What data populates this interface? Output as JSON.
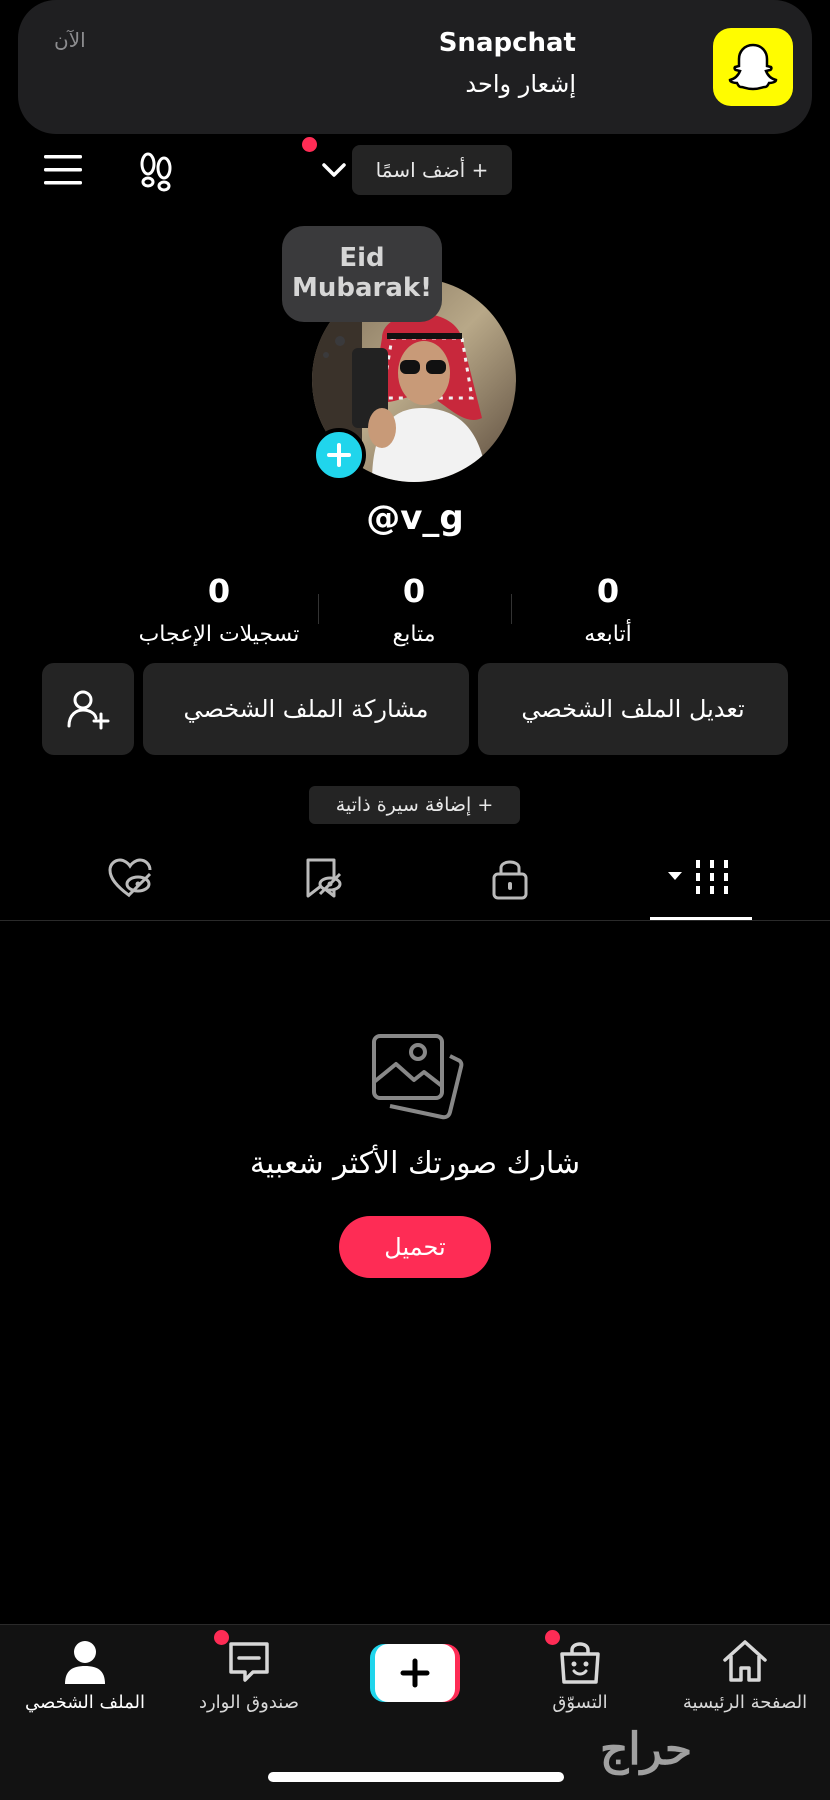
{
  "notification": {
    "app": "Snapchat",
    "body": "إشعار واحد",
    "time": "الآن",
    "icon": "snapchat-ghost-icon",
    "accent": "#fffc00"
  },
  "topbar": {
    "add_name_label": "+ أضف اسمًا",
    "menu_icon": "hamburger-menu-icon",
    "footsteps_icon": "footprints-icon"
  },
  "profile": {
    "bubble_text": "Eid Mubarak!",
    "username": "@v_g",
    "stats": [
      {
        "value": "0",
        "label": "أتابعه"
      },
      {
        "value": "0",
        "label": "متابع"
      },
      {
        "value": "0",
        "label": "تسجيلات الإعجاب"
      }
    ],
    "edit_button": "تعديل الملف الشخصي",
    "share_button": "مشاركة الملف الشخصي",
    "bio_button": "+ إضافة سيرة ذاتية"
  },
  "tabs": [
    "videos-grid-icon",
    "lock-icon",
    "bookmark-hidden-icon",
    "liked-hidden-icon"
  ],
  "empty_state": {
    "text": "شارك صورتك الأكثر شعبية",
    "upload_label": "تحميل"
  },
  "bottom_nav": [
    {
      "label": "الصفحة الرئيسية",
      "icon": "home-icon"
    },
    {
      "label": "التسوّق",
      "icon": "shopping-bag-icon"
    },
    {
      "label": "",
      "icon": "create-plus-icon"
    },
    {
      "label": "صندوق الوارد",
      "icon": "inbox-icon"
    },
    {
      "label": "الملف الشخصي",
      "icon": "profile-icon"
    }
  ],
  "watermark": "حراج",
  "colors": {
    "accent_red": "#fe2c55",
    "accent_cyan": "#20d5ec",
    "button_bg": "#242424"
  }
}
